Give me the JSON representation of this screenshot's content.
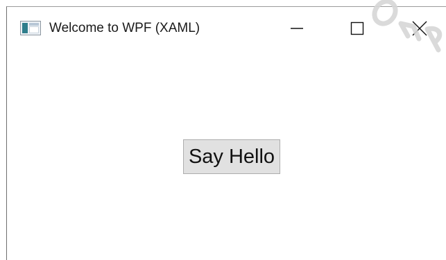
{
  "window": {
    "title": "Welcome to WPF (XAML)"
  },
  "icons": {
    "app": "wpf-window-icon",
    "minimize": "minimize-icon",
    "maximize": "maximize-icon",
    "close": "close-icon"
  },
  "content": {
    "button_label": "Say Hello"
  },
  "colors": {
    "window_background": "#ffffff",
    "button_background": "#e1e1e1",
    "button_border": "#adadad",
    "text": "#1a1a1a"
  }
}
